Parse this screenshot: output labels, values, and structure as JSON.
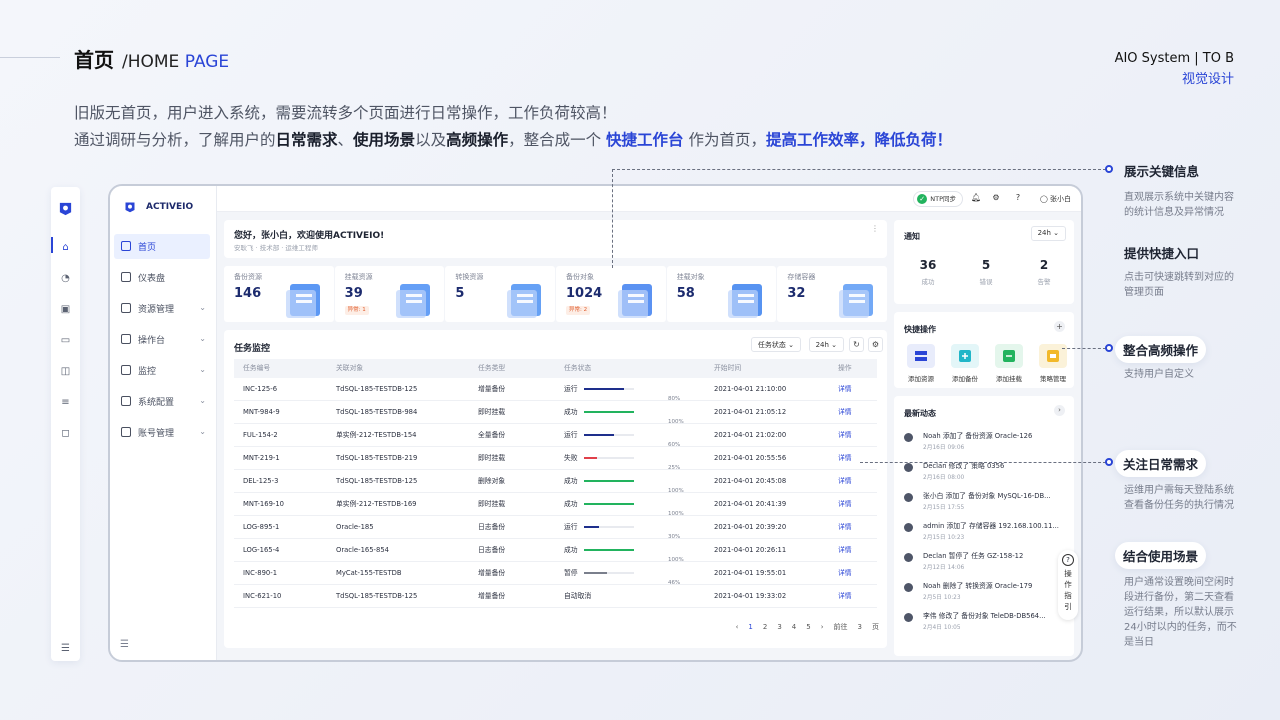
{
  "slide": {
    "title": "首页",
    "subtitle_prefix": "/HOME ",
    "subtitle_accent": "PAGE",
    "brand_line1": "AIO System | TO B",
    "brand_line2": "视觉设计",
    "intro_line1": "旧版无首页，用户进入系统，需要流转多个页面进行日常操作，工作负荷较高！",
    "intro_line2_a": "通过调研与分析，了解用户的",
    "intro_line2_b": "日常需求",
    "intro_line2_c": "、",
    "intro_line2_d": "使用场景",
    "intro_line2_e": "以及",
    "intro_line2_f": "高频操作",
    "intro_line2_g": "，整合成一个 ",
    "intro_line2_h": "快捷工作台",
    "intro_line2_i": " 作为首页，",
    "intro_line2_j": "提高工作效率，降低负荷！"
  },
  "app": {
    "brand": "ACTIVEIO",
    "menu": [
      {
        "label": "首页",
        "active": true
      },
      {
        "label": "仪表盘"
      },
      {
        "label": "资源管理",
        "expand": true
      },
      {
        "label": "操作台",
        "expand": true
      },
      {
        "label": "监控",
        "expand": true
      },
      {
        "label": "系统配置",
        "expand": true
      },
      {
        "label": "账号管理",
        "expand": true
      }
    ],
    "topbar": {
      "ntp": "NTP同步",
      "user": "张小白"
    },
    "welcome": {
      "title": "您好，张小白，欢迎使用ACTIVEIO!",
      "sub": "安耿飞 · 技术部 · 运维工程师"
    },
    "stats": [
      {
        "label": "备份资源",
        "value": "146",
        "art": "#3f86f2"
      },
      {
        "label": "挂载资源",
        "value": "39",
        "badge": "异常: 1",
        "art": "#4a8ef5"
      },
      {
        "label": "转换资源",
        "value": "5",
        "art": "#4b90f3"
      },
      {
        "label": "备份对象",
        "value": "1024",
        "badge": "异常: 2",
        "art": "#3e7ff0"
      },
      {
        "label": "挂载对象",
        "value": "58",
        "art": "#3a80ef"
      },
      {
        "label": "存储容器",
        "value": "32",
        "art": "#5a9af4"
      }
    ],
    "task": {
      "title": "任务监控",
      "filter_status": "任务状态 ⌄",
      "filter_time": "24h ⌄",
      "columns": [
        "任务编号",
        "关联对象",
        "任务类型",
        "任务状态",
        "开始时间",
        "操作"
      ],
      "rows": [
        {
          "id": "INC-125-6",
          "obj": "TdSQL-185-TESTDB-125",
          "type": "增量备份",
          "status": "运行",
          "pct": 80,
          "pct_label": "80%",
          "color": "#1e2f8c",
          "time": "2021-04-01 21:10:00",
          "op": "详情"
        },
        {
          "id": "MNT-984-9",
          "obj": "TdSQL-185-TESTDB-984",
          "type": "即时挂载",
          "status": "成功",
          "pct": 100,
          "pct_label": "100%",
          "color": "#22b35e",
          "time": "2021-04-01 21:05:12",
          "op": "详情"
        },
        {
          "id": "FUL-154-2",
          "obj": "单实例-212-TESTDB-154",
          "type": "全量备份",
          "status": "运行",
          "pct": 60,
          "pct_label": "60%",
          "color": "#1e2f8c",
          "time": "2021-04-01 21:02:00",
          "op": "详情"
        },
        {
          "id": "MNT-219-1",
          "obj": "TdSQL-185-TESTDB-219",
          "type": "即时挂载",
          "status": "失败",
          "pct": 25,
          "pct_label": "25%",
          "color": "#e0404a",
          "time": "2021-04-01 20:55:56",
          "op": "详情"
        },
        {
          "id": "DEL-125-3",
          "obj": "TdSQL-185-TESTDB-125",
          "type": "删除对象",
          "status": "成功",
          "pct": 100,
          "pct_label": "100%",
          "color": "#22b35e",
          "time": "2021-04-01 20:45:08",
          "op": "详情"
        },
        {
          "id": "MNT-169-10",
          "obj": "单实例-212-TESTDB-169",
          "type": "即时挂载",
          "status": "成功",
          "pct": 100,
          "pct_label": "100%",
          "color": "#22b35e",
          "time": "2021-04-01 20:41:39",
          "op": "详情"
        },
        {
          "id": "LOG-895-1",
          "obj": "Oracle-185",
          "type": "日志备份",
          "status": "运行",
          "pct": 30,
          "pct_label": "30%",
          "color": "#1e2f8c",
          "time": "2021-04-01 20:39:20",
          "op": "详情"
        },
        {
          "id": "LOG-165-4",
          "obj": "Oracle-165-854",
          "type": "日志备份",
          "status": "成功",
          "pct": 100,
          "pct_label": "100%",
          "color": "#22b35e",
          "time": "2021-04-01 20:26:11",
          "op": "详情"
        },
        {
          "id": "INC-890-1",
          "obj": "MyCat-155-TESTDB",
          "type": "增量备份",
          "status": "暂停",
          "pct": 46,
          "pct_label": "46%",
          "color": "#7a7f8c",
          "time": "2021-04-01 19:55:01",
          "op": "详情"
        },
        {
          "id": "INC-621-10",
          "obj": "TdSQL-185-TESTDB-125",
          "type": "增量备份",
          "status": "自动取消",
          "time": "2021-04-01 19:33:02",
          "op": "详情"
        }
      ],
      "pager": {
        "prev": "‹",
        "pages": [
          "1",
          "2",
          "3",
          "4",
          "5"
        ],
        "next": "›",
        "goto": "前往",
        "goto_val": "3",
        "unit": "页"
      }
    },
    "notice": {
      "title": "通知",
      "range": "24h ⌄",
      "items": [
        {
          "value": "36",
          "label": "成功"
        },
        {
          "value": "5",
          "label": "错误"
        },
        {
          "value": "2",
          "label": "告警"
        }
      ]
    },
    "quick": {
      "title": "快捷操作",
      "plus": "+",
      "items": [
        {
          "label": "添加资源",
          "color": "#e8ecfb"
        },
        {
          "label": "添加备份",
          "color": "#e3f6f8"
        },
        {
          "label": "添加挂载",
          "color": "#e4f6ec"
        },
        {
          "label": "策略管理",
          "color": "#fbf2d9"
        }
      ]
    },
    "feed": {
      "title": "最新动态",
      "arrow": "›",
      "items": [
        {
          "text": "Noah 添加了 备份资源 Oracle-126",
          "date": "2月16日 09:06"
        },
        {
          "text": "Declan 修改了 策略 0356",
          "date": "2月16日 08:00"
        },
        {
          "text": "张小白 添加了 备份对象 MySQL-16-DB...",
          "date": "2月15日 17:55"
        },
        {
          "text": "admin 添加了 存储容器 192.168.100.11...",
          "date": "2月15日 10:23"
        },
        {
          "text": "Declan 暂停了 任务 GZ-158-12",
          "date": "2月12日 14:06"
        },
        {
          "text": "Noah 删除了 转换资源 Oracle-179",
          "date": "2月5日 10:23"
        },
        {
          "text": "李伟 修改了 备份对象 TeleDB-DB564...",
          "date": "2月4日 10:05"
        }
      ]
    },
    "guide": {
      "q": "?",
      "text": [
        "操",
        "作",
        "指",
        "引"
      ]
    }
  },
  "annotations": [
    {
      "title": "展示关键信息",
      "desc": [
        "直观展示系统中关键内容",
        "的统计信息及异常情况"
      ]
    },
    {
      "title": "提供快捷入口",
      "desc": [
        "点击可快速跳转到对应的",
        "管理页面"
      ]
    },
    {
      "title": "整合高频操作",
      "desc": [
        "支持用户自定义"
      ]
    },
    {
      "title": "关注日常需求",
      "desc": [
        "运维用户需每天登陆系统",
        "查看备份任务的执行情况"
      ]
    },
    {
      "title": "结合使用场景",
      "desc": [
        "用户通常设置晚间空闲时",
        "段进行备份，第二天查看",
        "运行结果，所以默认展示",
        "24小时以内的任务，而不",
        "是当日"
      ]
    }
  ]
}
